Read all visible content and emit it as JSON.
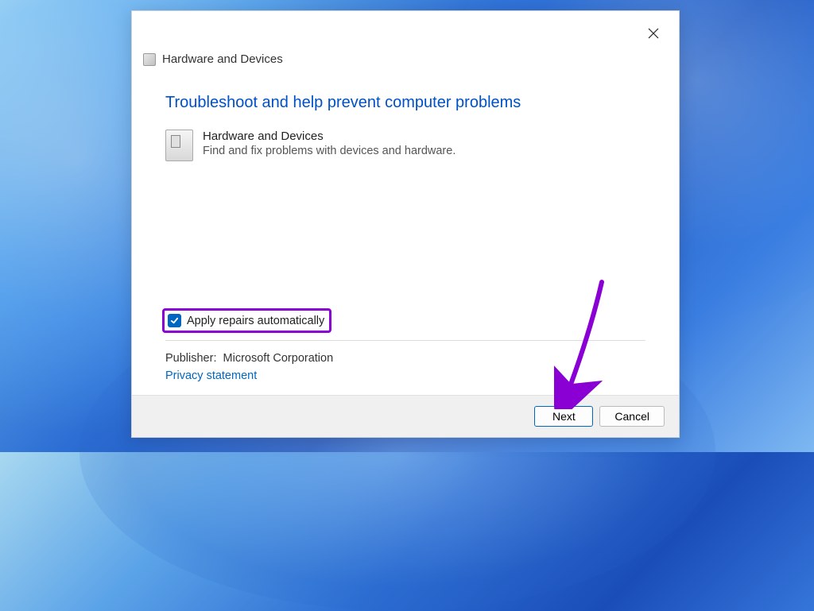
{
  "header": {
    "title": "Hardware and Devices"
  },
  "main": {
    "heading": "Troubleshoot and help prevent computer problems",
    "device": {
      "title": "Hardware and Devices",
      "description": "Find and fix problems with devices and hardware."
    },
    "checkbox_label": "Apply repairs automatically",
    "publisher_label": "Publisher:",
    "publisher_value": "Microsoft Corporation",
    "privacy_link": "Privacy statement"
  },
  "footer": {
    "next_label": "Next",
    "cancel_label": "Cancel"
  }
}
